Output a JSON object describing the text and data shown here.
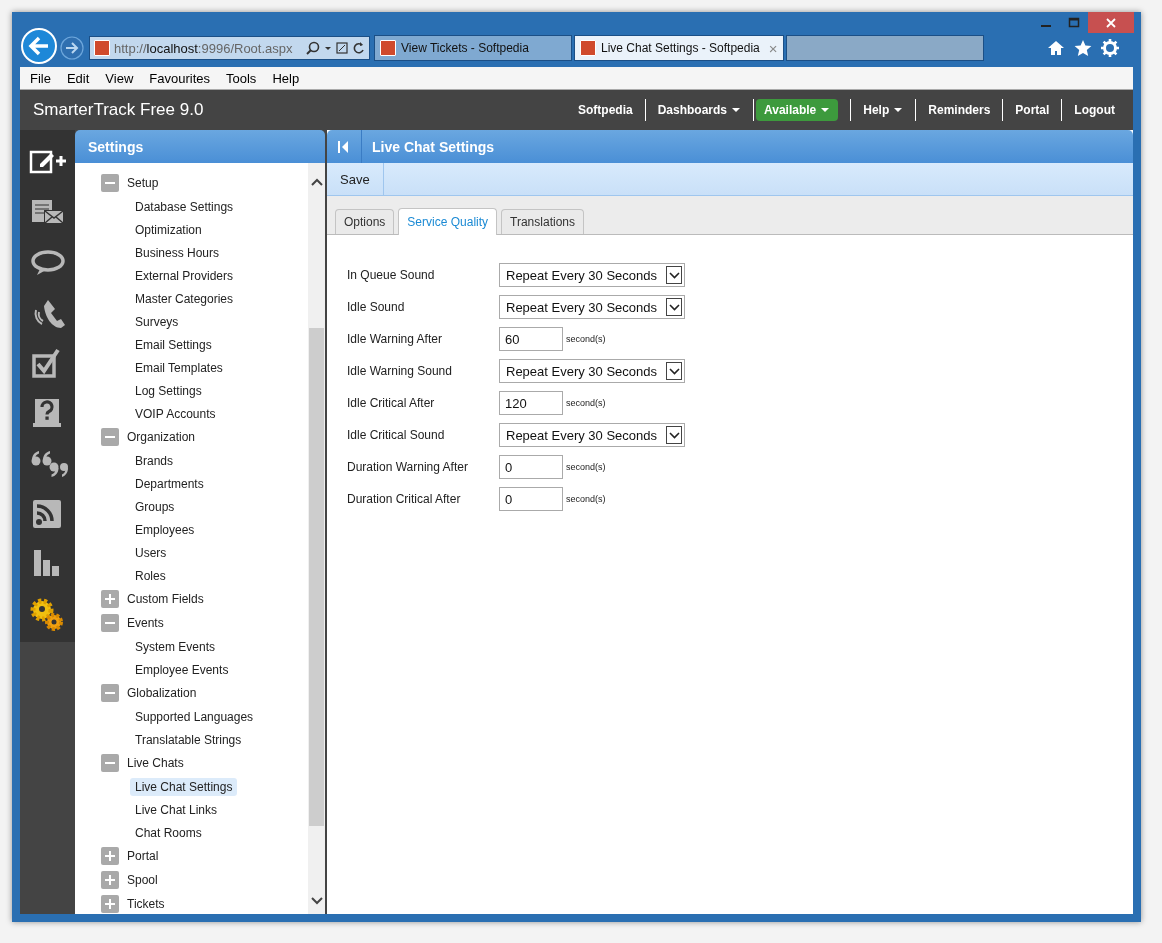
{
  "browser": {
    "address": "http://**localhost**:9996/Root.aspx",
    "tabs": [
      {
        "label": "View Tickets - Softpedia",
        "selected": false
      },
      {
        "label": "Live Chat Settings - Softpedia",
        "selected": true
      }
    ],
    "close_tab": "×"
  },
  "menu": [
    "File",
    "Edit",
    "View",
    "Favourites",
    "Tools",
    "Help"
  ],
  "app": {
    "title": "SmarterTrack Free 9.0",
    "nav": [
      {
        "label": "Softpedia",
        "kind": "link"
      },
      {
        "label": "Dashboards",
        "kind": "dropdown"
      },
      {
        "label": "Available",
        "kind": "status"
      },
      {
        "label": "Help",
        "kind": "dropdown"
      },
      {
        "label": "Reminders",
        "kind": "link"
      },
      {
        "label": "Portal",
        "kind": "link"
      },
      {
        "label": "Logout",
        "kind": "link"
      }
    ]
  },
  "rail": [
    {
      "kind": "compose"
    },
    {
      "kind": "mail"
    },
    {
      "kind": "chat"
    },
    {
      "kind": "phone"
    },
    {
      "kind": "task"
    },
    {
      "kind": "help"
    },
    {
      "kind": "quote"
    },
    {
      "kind": "rss"
    },
    {
      "kind": "chart"
    },
    {
      "kind": "gears"
    }
  ],
  "sidebar": {
    "title": "Settings",
    "tree": [
      {
        "label": "Setup",
        "expanded": true,
        "children": [
          {
            "label": "Database Settings",
            "selected": false
          },
          {
            "label": "Optimization",
            "selected": false
          },
          {
            "label": "Business Hours",
            "selected": false
          },
          {
            "label": "External Providers",
            "selected": false
          },
          {
            "label": "Master Categories",
            "selected": false
          },
          {
            "label": "Surveys",
            "selected": false
          },
          {
            "label": "Email Settings",
            "selected": false
          },
          {
            "label": "Email Templates",
            "selected": false
          },
          {
            "label": "Log Settings",
            "selected": false
          },
          {
            "label": "VOIP Accounts",
            "selected": false
          }
        ]
      },
      {
        "label": "Organization",
        "expanded": true,
        "children": [
          {
            "label": "Brands",
            "selected": false
          },
          {
            "label": "Departments",
            "selected": false
          },
          {
            "label": "Groups",
            "selected": false
          },
          {
            "label": "Employees",
            "selected": false
          },
          {
            "label": "Users",
            "selected": false
          },
          {
            "label": "Roles",
            "selected": false
          }
        ]
      },
      {
        "label": "Custom Fields",
        "expanded": false
      },
      {
        "label": "Events",
        "expanded": true,
        "children": [
          {
            "label": "System Events",
            "selected": false
          },
          {
            "label": "Employee Events",
            "selected": false
          }
        ]
      },
      {
        "label": "Globalization",
        "expanded": true,
        "children": [
          {
            "label": "Supported Languages",
            "selected": false
          },
          {
            "label": "Translatable Strings",
            "selected": false
          }
        ]
      },
      {
        "label": "Live Chats",
        "expanded": true,
        "children": [
          {
            "label": "Live Chat Settings",
            "selected": true
          },
          {
            "label": "Live Chat Links",
            "selected": false
          },
          {
            "label": "Chat Rooms",
            "selected": false
          }
        ]
      },
      {
        "label": "Portal",
        "expanded": false
      },
      {
        "label": "Spool",
        "expanded": false
      },
      {
        "label": "Tickets",
        "expanded": false
      }
    ]
  },
  "content": {
    "title": "Live Chat Settings",
    "toolbar": [
      "Save"
    ],
    "tabs": [
      {
        "label": "Options",
        "selected": false
      },
      {
        "label": "Service Quality",
        "selected": true
      },
      {
        "label": "Translations",
        "selected": false
      }
    ],
    "fields": [
      {
        "label": "In Queue Sound",
        "kind": "select",
        "value": "Repeat Every 30 Seconds"
      },
      {
        "label": "Idle Sound",
        "kind": "select",
        "value": "Repeat Every 30 Seconds"
      },
      {
        "label": "Idle Warning After",
        "kind": "number",
        "value": "60",
        "unit": "second(s)"
      },
      {
        "label": "Idle Warning Sound",
        "kind": "select",
        "value": "Repeat Every 30 Seconds"
      },
      {
        "label": "Idle Critical After",
        "kind": "number",
        "value": "120",
        "unit": "second(s)"
      },
      {
        "label": "Idle Critical Sound",
        "kind": "select",
        "value": "Repeat Every 30 Seconds"
      },
      {
        "label": "Duration Warning After",
        "kind": "number",
        "value": "0",
        "unit": "second(s)"
      },
      {
        "label": "Duration Critical After",
        "kind": "number",
        "value": "0",
        "unit": "second(s)"
      }
    ]
  }
}
